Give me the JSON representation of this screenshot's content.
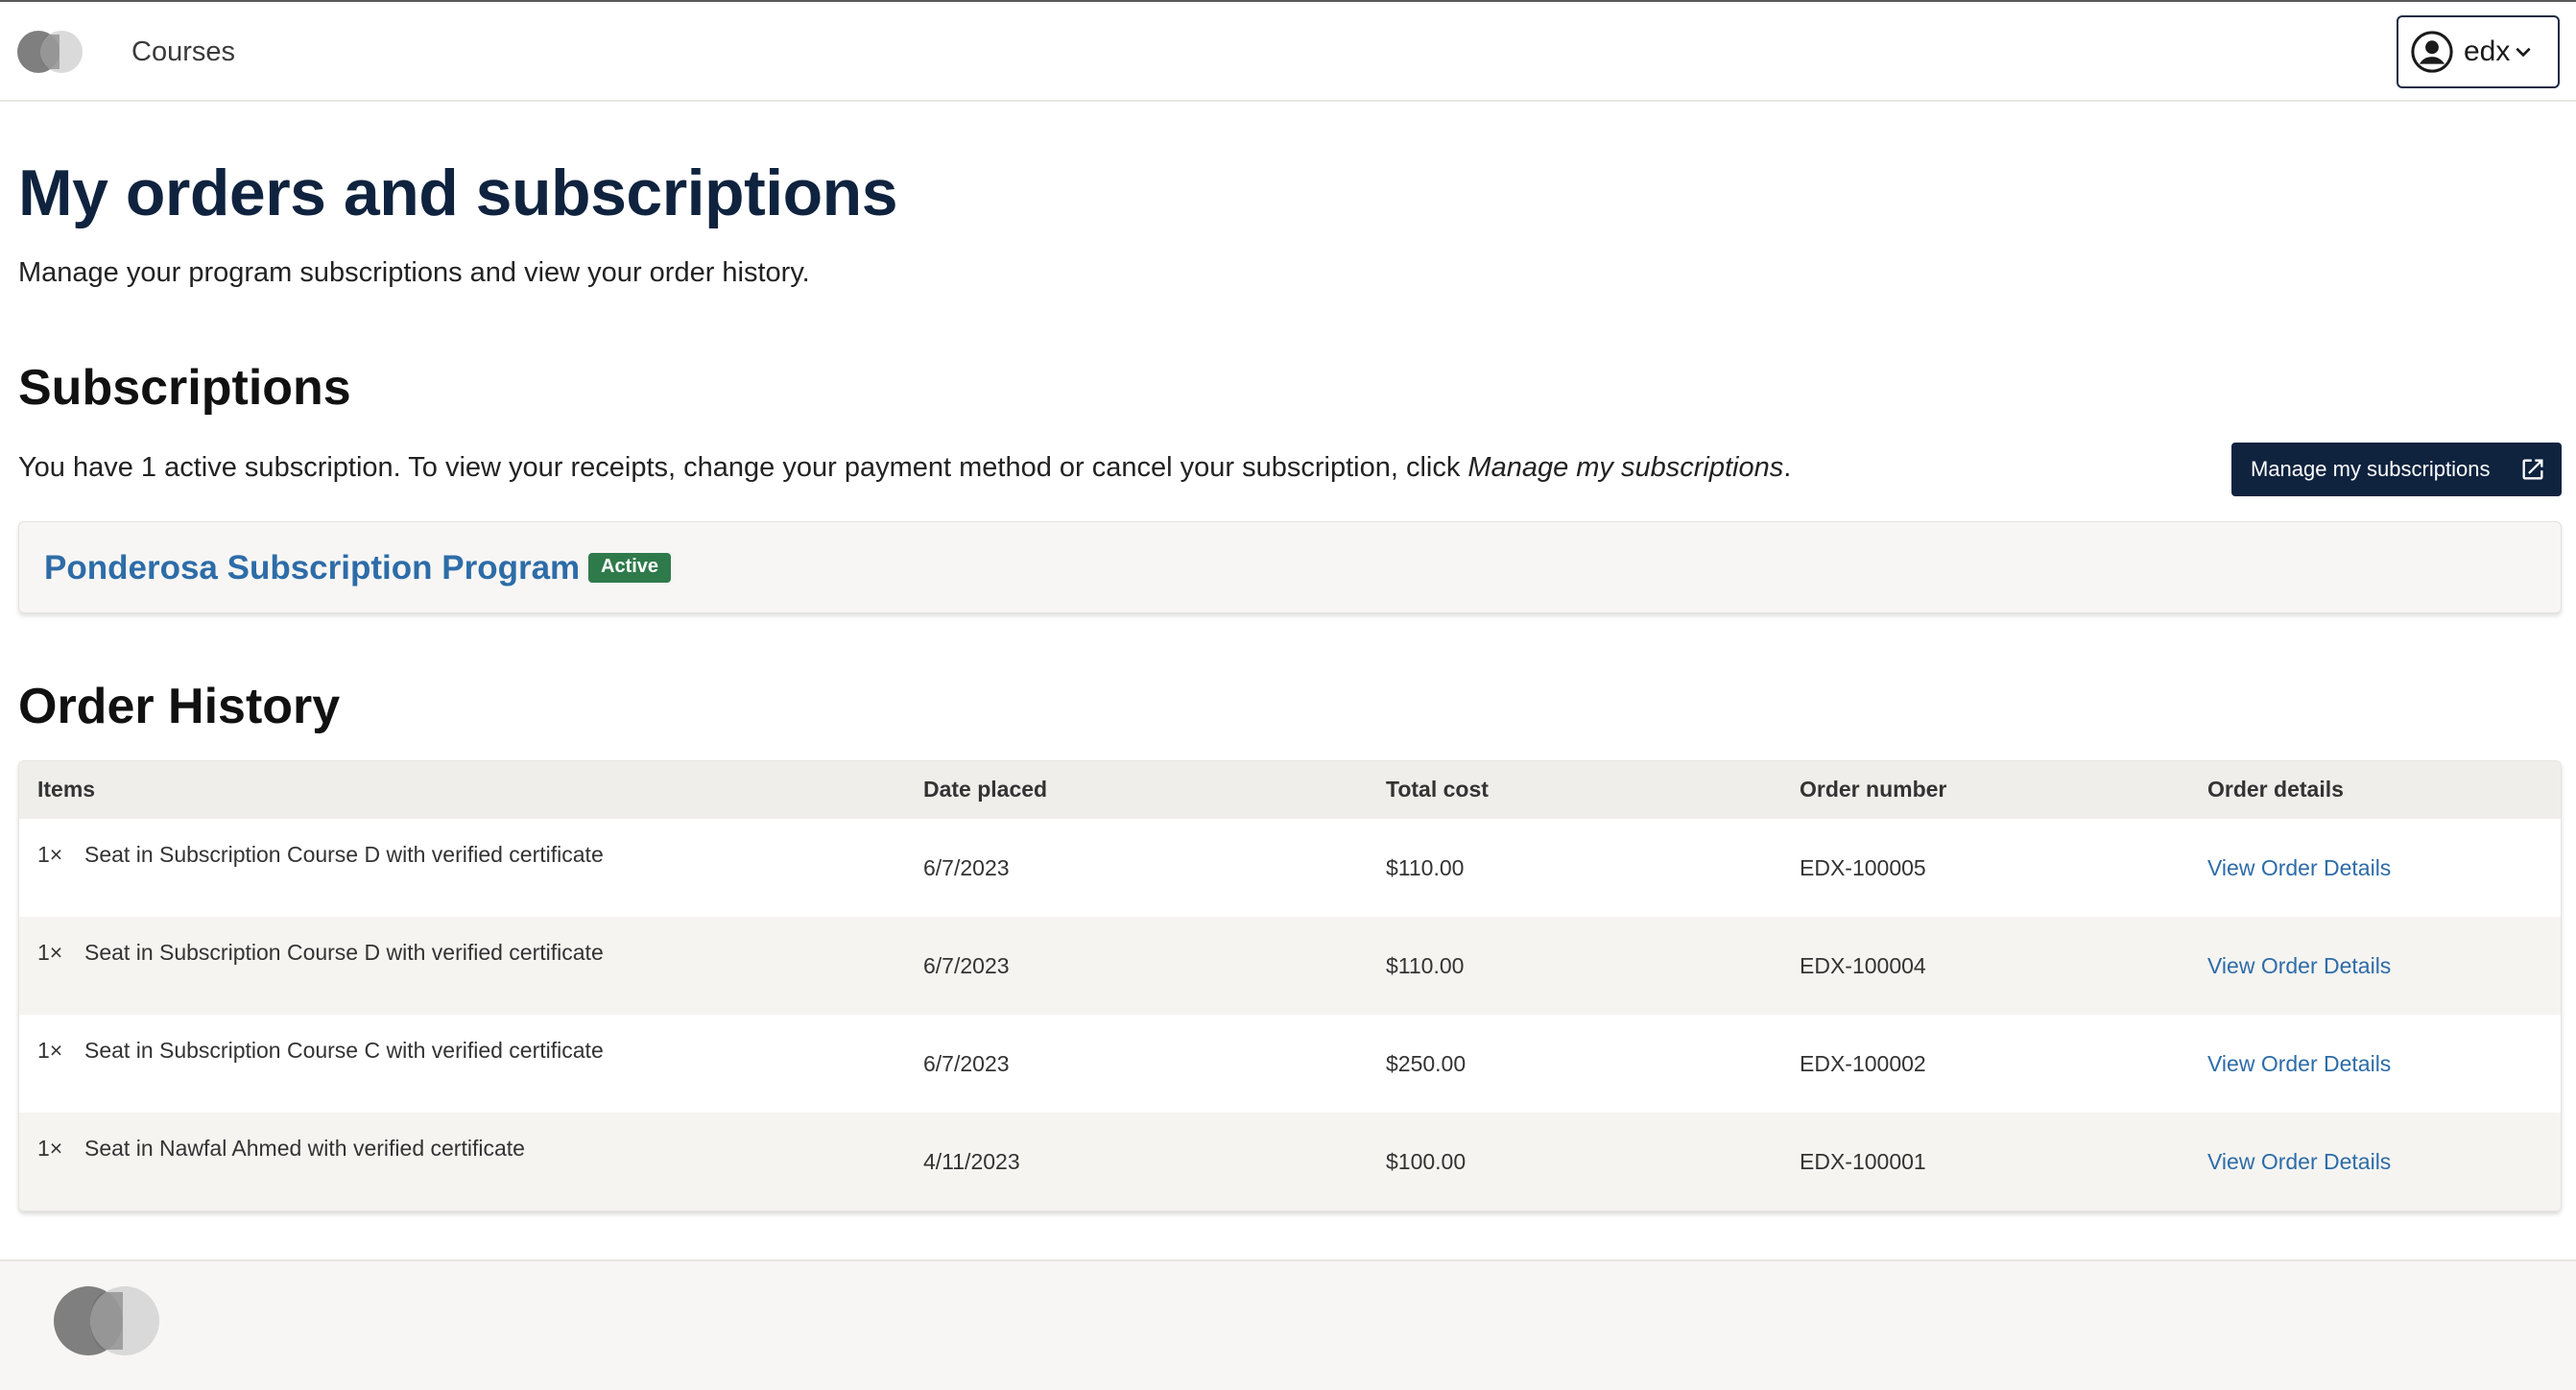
{
  "header": {
    "nav_courses": "Courses",
    "username": "edx",
    "logo_icon": "logo-icon",
    "user_icon": "account-circle-icon",
    "chevron_icon": "chevron-down-icon"
  },
  "main": {
    "title": "My orders and subscriptions",
    "subtitle": "Manage your program subscriptions and view your order history.",
    "subscriptions": {
      "heading": "Subscriptions",
      "desc_prefix": "You have 1 active subscription. To view your receipts, change your payment method or cancel your subscription, click ",
      "desc_link": "Manage my subscriptions",
      "desc_suffix": ".",
      "manage_button": "Manage my subscriptions",
      "manage_icon": "external-link-icon",
      "program_name": "Ponderosa Subscription Program",
      "status": "Active"
    },
    "order_history": {
      "heading": "Order History",
      "columns": [
        "Items",
        "Date placed",
        "Total cost",
        "Order number",
        "Order details"
      ],
      "rows": [
        {
          "qty": "1×",
          "item": "Seat in Subscription Course D with verified certificate",
          "date": "6/7/2023",
          "cost": "$110.00",
          "number": "EDX-100005",
          "details": "View Order Details"
        },
        {
          "qty": "1×",
          "item": "Seat in Subscription Course D with verified certificate",
          "date": "6/7/2023",
          "cost": "$110.00",
          "number": "EDX-100004",
          "details": "View Order Details"
        },
        {
          "qty": "1×",
          "item": "Seat in Subscription Course C with verified certificate",
          "date": "6/7/2023",
          "cost": "$250.00",
          "number": "EDX-100002",
          "details": "View Order Details"
        },
        {
          "qty": "1×",
          "item": "Seat in Nawfal Ahmed with verified certificate",
          "date": "4/11/2023",
          "cost": "$100.00",
          "number": "EDX-100001",
          "details": "View Order Details"
        }
      ]
    }
  },
  "colors": {
    "navy": "#0f233f",
    "link_blue": "#2d6ca8",
    "badge_green": "#2f7a4b"
  }
}
